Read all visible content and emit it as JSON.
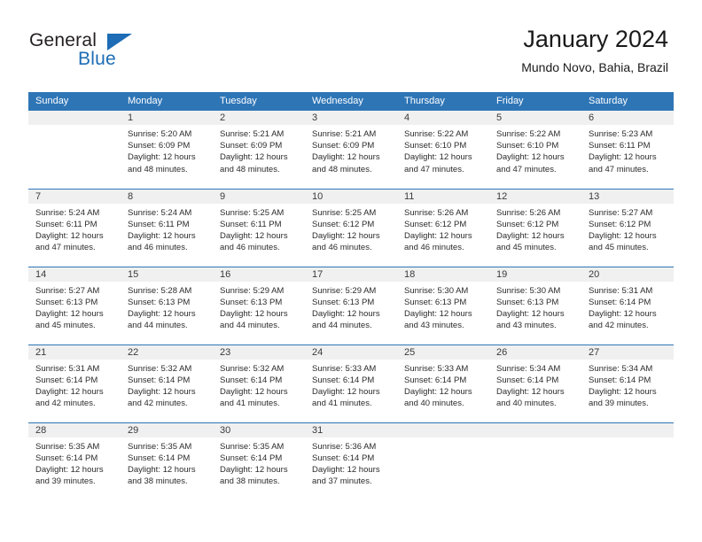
{
  "brand": {
    "word_general": "General",
    "word_blue": "Blue",
    "accent_color": "#2e75b6",
    "logo_blue": "#1d6cb5"
  },
  "header": {
    "title": "January 2024",
    "subtitle": "Mundo Novo, Bahia, Brazil"
  },
  "calendar": {
    "weekday_headers": [
      "Sunday",
      "Monday",
      "Tuesday",
      "Wednesday",
      "Thursday",
      "Friday",
      "Saturday"
    ],
    "labels": {
      "sunrise": "Sunrise:",
      "sunset": "Sunset:",
      "daylight": "Daylight:"
    },
    "weeks": [
      [
        {
          "day": "",
          "blank": true,
          "sunrise": "",
          "sunset": "",
          "daylight_a": "",
          "daylight_b": ""
        },
        {
          "day": "1",
          "sunrise": "Sunrise: 5:20 AM",
          "sunset": "Sunset: 6:09 PM",
          "daylight_a": "Daylight: 12 hours",
          "daylight_b": "and 48 minutes."
        },
        {
          "day": "2",
          "sunrise": "Sunrise: 5:21 AM",
          "sunset": "Sunset: 6:09 PM",
          "daylight_a": "Daylight: 12 hours",
          "daylight_b": "and 48 minutes."
        },
        {
          "day": "3",
          "sunrise": "Sunrise: 5:21 AM",
          "sunset": "Sunset: 6:09 PM",
          "daylight_a": "Daylight: 12 hours",
          "daylight_b": "and 48 minutes."
        },
        {
          "day": "4",
          "sunrise": "Sunrise: 5:22 AM",
          "sunset": "Sunset: 6:10 PM",
          "daylight_a": "Daylight: 12 hours",
          "daylight_b": "and 47 minutes."
        },
        {
          "day": "5",
          "sunrise": "Sunrise: 5:22 AM",
          "sunset": "Sunset: 6:10 PM",
          "daylight_a": "Daylight: 12 hours",
          "daylight_b": "and 47 minutes."
        },
        {
          "day": "6",
          "sunrise": "Sunrise: 5:23 AM",
          "sunset": "Sunset: 6:11 PM",
          "daylight_a": "Daylight: 12 hours",
          "daylight_b": "and 47 minutes."
        }
      ],
      [
        {
          "day": "7",
          "sunrise": "Sunrise: 5:24 AM",
          "sunset": "Sunset: 6:11 PM",
          "daylight_a": "Daylight: 12 hours",
          "daylight_b": "and 47 minutes."
        },
        {
          "day": "8",
          "sunrise": "Sunrise: 5:24 AM",
          "sunset": "Sunset: 6:11 PM",
          "daylight_a": "Daylight: 12 hours",
          "daylight_b": "and 46 minutes."
        },
        {
          "day": "9",
          "sunrise": "Sunrise: 5:25 AM",
          "sunset": "Sunset: 6:11 PM",
          "daylight_a": "Daylight: 12 hours",
          "daylight_b": "and 46 minutes."
        },
        {
          "day": "10",
          "sunrise": "Sunrise: 5:25 AM",
          "sunset": "Sunset: 6:12 PM",
          "daylight_a": "Daylight: 12 hours",
          "daylight_b": "and 46 minutes."
        },
        {
          "day": "11",
          "sunrise": "Sunrise: 5:26 AM",
          "sunset": "Sunset: 6:12 PM",
          "daylight_a": "Daylight: 12 hours",
          "daylight_b": "and 46 minutes."
        },
        {
          "day": "12",
          "sunrise": "Sunrise: 5:26 AM",
          "sunset": "Sunset: 6:12 PM",
          "daylight_a": "Daylight: 12 hours",
          "daylight_b": "and 45 minutes."
        },
        {
          "day": "13",
          "sunrise": "Sunrise: 5:27 AM",
          "sunset": "Sunset: 6:12 PM",
          "daylight_a": "Daylight: 12 hours",
          "daylight_b": "and 45 minutes."
        }
      ],
      [
        {
          "day": "14",
          "sunrise": "Sunrise: 5:27 AM",
          "sunset": "Sunset: 6:13 PM",
          "daylight_a": "Daylight: 12 hours",
          "daylight_b": "and 45 minutes."
        },
        {
          "day": "15",
          "sunrise": "Sunrise: 5:28 AM",
          "sunset": "Sunset: 6:13 PM",
          "daylight_a": "Daylight: 12 hours",
          "daylight_b": "and 44 minutes."
        },
        {
          "day": "16",
          "sunrise": "Sunrise: 5:29 AM",
          "sunset": "Sunset: 6:13 PM",
          "daylight_a": "Daylight: 12 hours",
          "daylight_b": "and 44 minutes."
        },
        {
          "day": "17",
          "sunrise": "Sunrise: 5:29 AM",
          "sunset": "Sunset: 6:13 PM",
          "daylight_a": "Daylight: 12 hours",
          "daylight_b": "and 44 minutes."
        },
        {
          "day": "18",
          "sunrise": "Sunrise: 5:30 AM",
          "sunset": "Sunset: 6:13 PM",
          "daylight_a": "Daylight: 12 hours",
          "daylight_b": "and 43 minutes."
        },
        {
          "day": "19",
          "sunrise": "Sunrise: 5:30 AM",
          "sunset": "Sunset: 6:13 PM",
          "daylight_a": "Daylight: 12 hours",
          "daylight_b": "and 43 minutes."
        },
        {
          "day": "20",
          "sunrise": "Sunrise: 5:31 AM",
          "sunset": "Sunset: 6:14 PM",
          "daylight_a": "Daylight: 12 hours",
          "daylight_b": "and 42 minutes."
        }
      ],
      [
        {
          "day": "21",
          "sunrise": "Sunrise: 5:31 AM",
          "sunset": "Sunset: 6:14 PM",
          "daylight_a": "Daylight: 12 hours",
          "daylight_b": "and 42 minutes."
        },
        {
          "day": "22",
          "sunrise": "Sunrise: 5:32 AM",
          "sunset": "Sunset: 6:14 PM",
          "daylight_a": "Daylight: 12 hours",
          "daylight_b": "and 42 minutes."
        },
        {
          "day": "23",
          "sunrise": "Sunrise: 5:32 AM",
          "sunset": "Sunset: 6:14 PM",
          "daylight_a": "Daylight: 12 hours",
          "daylight_b": "and 41 minutes."
        },
        {
          "day": "24",
          "sunrise": "Sunrise: 5:33 AM",
          "sunset": "Sunset: 6:14 PM",
          "daylight_a": "Daylight: 12 hours",
          "daylight_b": "and 41 minutes."
        },
        {
          "day": "25",
          "sunrise": "Sunrise: 5:33 AM",
          "sunset": "Sunset: 6:14 PM",
          "daylight_a": "Daylight: 12 hours",
          "daylight_b": "and 40 minutes."
        },
        {
          "day": "26",
          "sunrise": "Sunrise: 5:34 AM",
          "sunset": "Sunset: 6:14 PM",
          "daylight_a": "Daylight: 12 hours",
          "daylight_b": "and 40 minutes."
        },
        {
          "day": "27",
          "sunrise": "Sunrise: 5:34 AM",
          "sunset": "Sunset: 6:14 PM",
          "daylight_a": "Daylight: 12 hours",
          "daylight_b": "and 39 minutes."
        }
      ],
      [
        {
          "day": "28",
          "sunrise": "Sunrise: 5:35 AM",
          "sunset": "Sunset: 6:14 PM",
          "daylight_a": "Daylight: 12 hours",
          "daylight_b": "and 39 minutes."
        },
        {
          "day": "29",
          "sunrise": "Sunrise: 5:35 AM",
          "sunset": "Sunset: 6:14 PM",
          "daylight_a": "Daylight: 12 hours",
          "daylight_b": "and 38 minutes."
        },
        {
          "day": "30",
          "sunrise": "Sunrise: 5:35 AM",
          "sunset": "Sunset: 6:14 PM",
          "daylight_a": "Daylight: 12 hours",
          "daylight_b": "and 38 minutes."
        },
        {
          "day": "31",
          "sunrise": "Sunrise: 5:36 AM",
          "sunset": "Sunset: 6:14 PM",
          "daylight_a": "Daylight: 12 hours",
          "daylight_b": "and 37 minutes."
        },
        {
          "day": "",
          "blank": true,
          "sunrise": "",
          "sunset": "",
          "daylight_a": "",
          "daylight_b": ""
        },
        {
          "day": "",
          "blank": true,
          "sunrise": "",
          "sunset": "",
          "daylight_a": "",
          "daylight_b": ""
        },
        {
          "day": "",
          "blank": true,
          "sunrise": "",
          "sunset": "",
          "daylight_a": "",
          "daylight_b": ""
        }
      ]
    ]
  }
}
